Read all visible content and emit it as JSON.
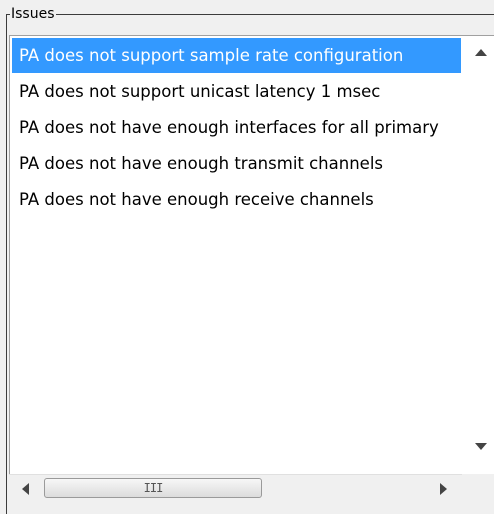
{
  "group": {
    "title": "Issues"
  },
  "issues": {
    "items": [
      "PA does not support sample rate configuration",
      "PA does not support unicast latency 1 msec",
      "PA does not have enough interfaces for all primary",
      "PA does not have enough transmit channels",
      "PA does not have enough receive channels"
    ],
    "selected_index": 0
  },
  "scrollbar": {
    "thumb_grip": "III",
    "up_icon": "up-arrow-icon",
    "down_icon": "down-arrow-icon",
    "left_icon": "left-arrow-icon",
    "right_icon": "right-arrow-icon"
  },
  "colors": {
    "selection": "#3399ff",
    "selection_text": "#ffffff",
    "list_bg": "#ffffff",
    "window_bg": "#f0f0f0"
  }
}
